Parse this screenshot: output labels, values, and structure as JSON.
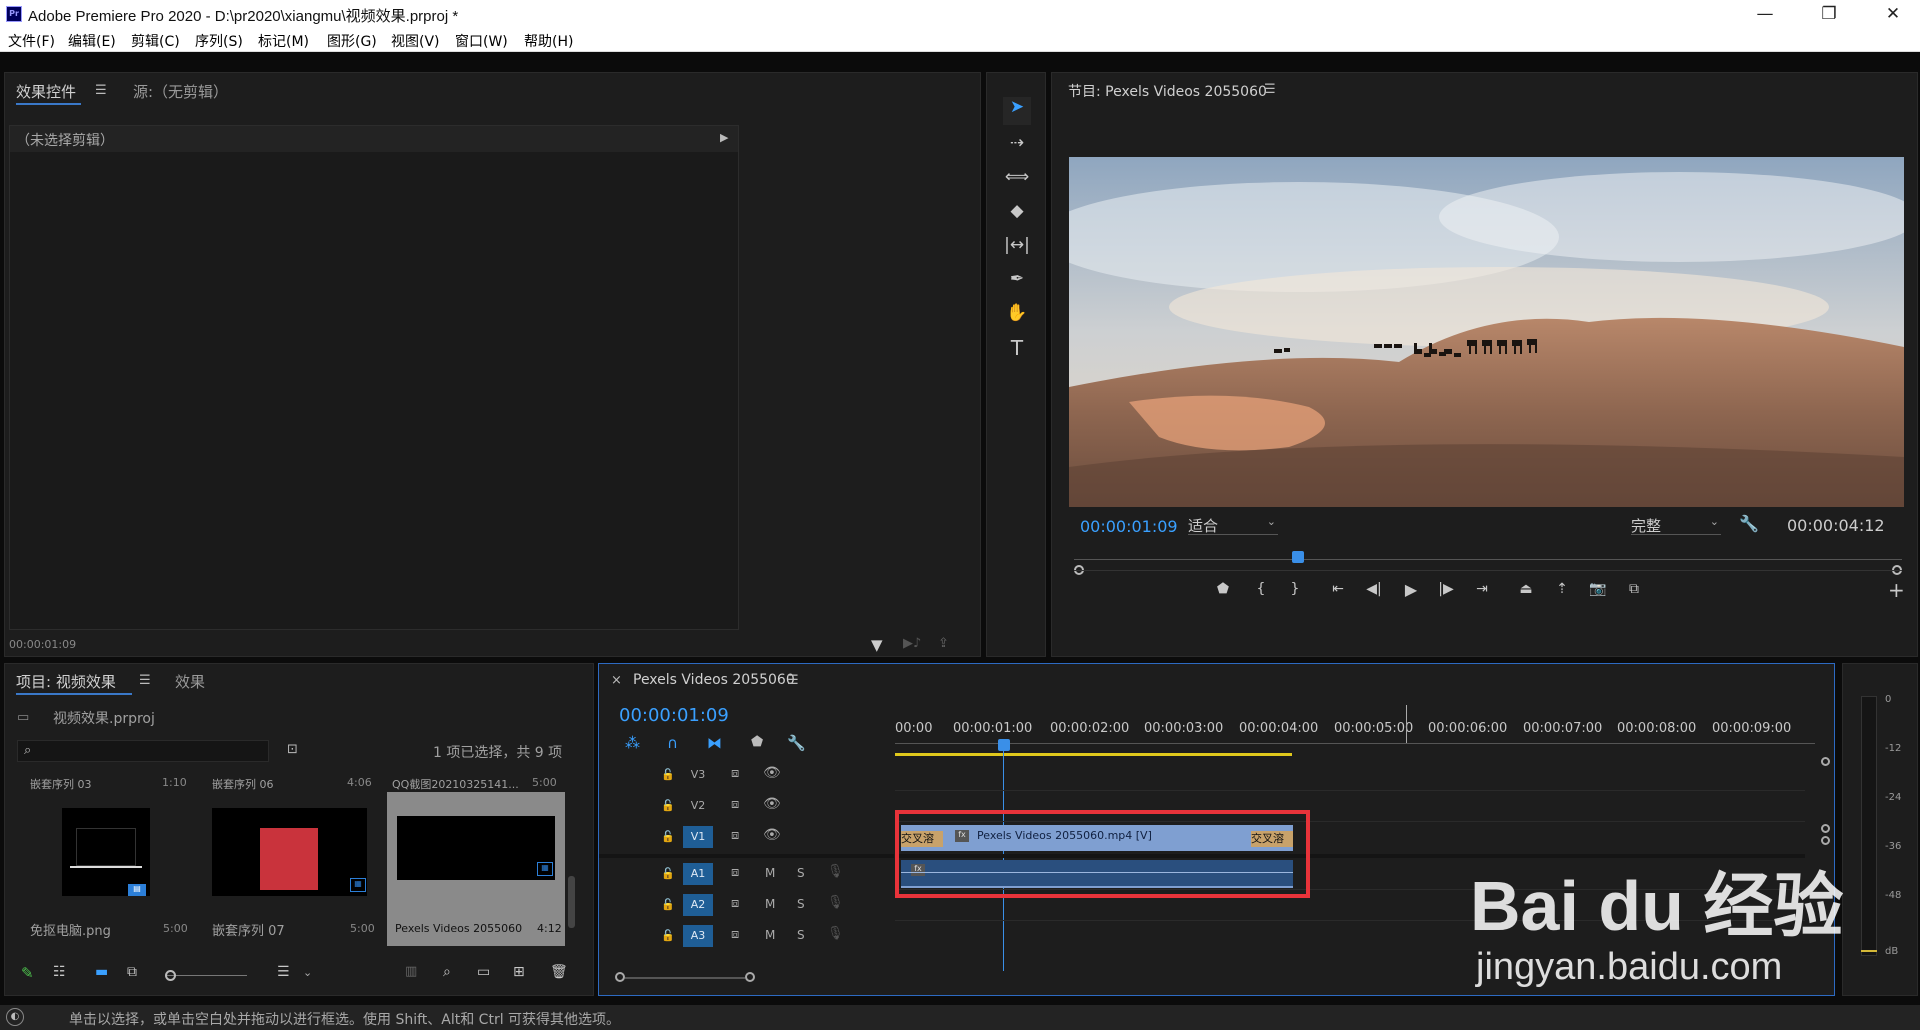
{
  "window": {
    "app_badge": "Pr",
    "title": "Adobe Premiere Pro 2020 - D:\\pr2020\\xiangmu\\视频效果.prproj *",
    "minimize": "—",
    "maximize": "❐",
    "close": "✕"
  },
  "menu": [
    "文件(F)",
    "编辑(E)",
    "剪辑(C)",
    "序列(S)",
    "标记(M)",
    "图形(G)",
    "视图(V)",
    "窗口(W)",
    "帮助(H)"
  ],
  "effect_controls": {
    "tab_active": "效果控件",
    "tab_source": "源:（无剪辑）",
    "no_clip": "（未选择剪辑）",
    "timecode": "00:00:01:09"
  },
  "tools": {
    "selection": "selection-tool-icon",
    "track_select": "track-select-icon",
    "ripple": "ripple-edit-icon",
    "razor": "razor-icon",
    "slip": "slip-icon",
    "pen": "pen-icon",
    "hand": "hand-icon",
    "type_label": "T"
  },
  "program": {
    "title": "节目: Pexels Videos 2055060",
    "timecode": "00:00:01:09",
    "fit_label": "适合",
    "quality_label": "完整",
    "duration": "00:00:04:12",
    "playhead_fraction": 0.27,
    "controls": {
      "mark_in": "{",
      "mark_out": "}",
      "add_button": "+"
    }
  },
  "project": {
    "tab_active": "项目: 视频效果",
    "tab_effects": "效果",
    "file": "视频效果.prproj",
    "search_placeholder": "",
    "selection_status": "1 项已选择，共 9 项",
    "items_top": [
      {
        "name": "嵌套序列 03",
        "duration": "1:10"
      },
      {
        "name": "嵌套序列 06",
        "duration": "4:06"
      },
      {
        "name": "QQ截图20210325141...",
        "duration": "5:00"
      }
    ],
    "items_bottom": [
      {
        "name": "免抠电脑.png",
        "duration": "5:00"
      },
      {
        "name": "嵌套序列 07",
        "duration": "5:00"
      },
      {
        "name": "Pexels Videos 2055060",
        "duration": "4:12"
      }
    ]
  },
  "timeline": {
    "close": "×",
    "title": "Pexels Videos 2055060",
    "timecode": "00:00:01:09",
    "ruler": [
      "00:00",
      "00:00:01:00",
      "00:00:02:00",
      "00:00:03:00",
      "00:00:04:00",
      "00:00:05:00",
      "00:00:06:00",
      "00:00:07:00",
      "00:00:08:00",
      "00:00:09:00"
    ],
    "tracks": [
      {
        "id": "V3",
        "type": "video"
      },
      {
        "id": "V2",
        "type": "video"
      },
      {
        "id": "V1",
        "type": "video"
      },
      {
        "id": "A1",
        "type": "audio",
        "m": "M",
        "s": "S"
      },
      {
        "id": "A2",
        "type": "audio",
        "m": "M",
        "s": "S"
      },
      {
        "id": "A3",
        "type": "audio",
        "m": "M",
        "s": "S"
      }
    ],
    "clip_label": "Pexels Videos 2055060.mp4 [V]",
    "transition_label": "交叉溶",
    "fx_badge": "fx"
  },
  "meter": {
    "labels": [
      "0",
      "-12",
      "-24",
      "-36",
      "-48",
      "dB"
    ]
  },
  "status_bar": {
    "text": "单击以选择，或单击空白处并拖动以进行框选。使用 Shift、Alt和 Ctrl 可获得其他选项。"
  },
  "watermark": {
    "brand": "Bai du 经验",
    "url": "jingyan.baidu.com"
  }
}
